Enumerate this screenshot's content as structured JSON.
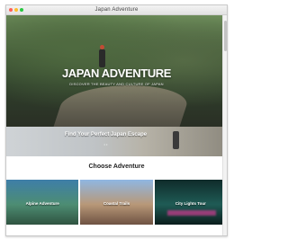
{
  "window": {
    "title": "Japan Adventure",
    "colors": {
      "close": "#ff5f57",
      "minimize": "#febc2e",
      "maximize": "#28c840"
    }
  },
  "hero": {
    "title": "JAPAN ADVENTURE",
    "subtitle": "DISCOVER THE BEAUTY AND CULTURE OF JAPAN"
  },
  "promo": {
    "text": "Find Your Perfect Japan Escape",
    "indicator": "• •"
  },
  "section": {
    "title": "Choose Adventure"
  },
  "cards": [
    {
      "label": "Alpine Adventure"
    },
    {
      "label": "Coastal Trails"
    },
    {
      "label": "City Lights Tour"
    }
  ]
}
